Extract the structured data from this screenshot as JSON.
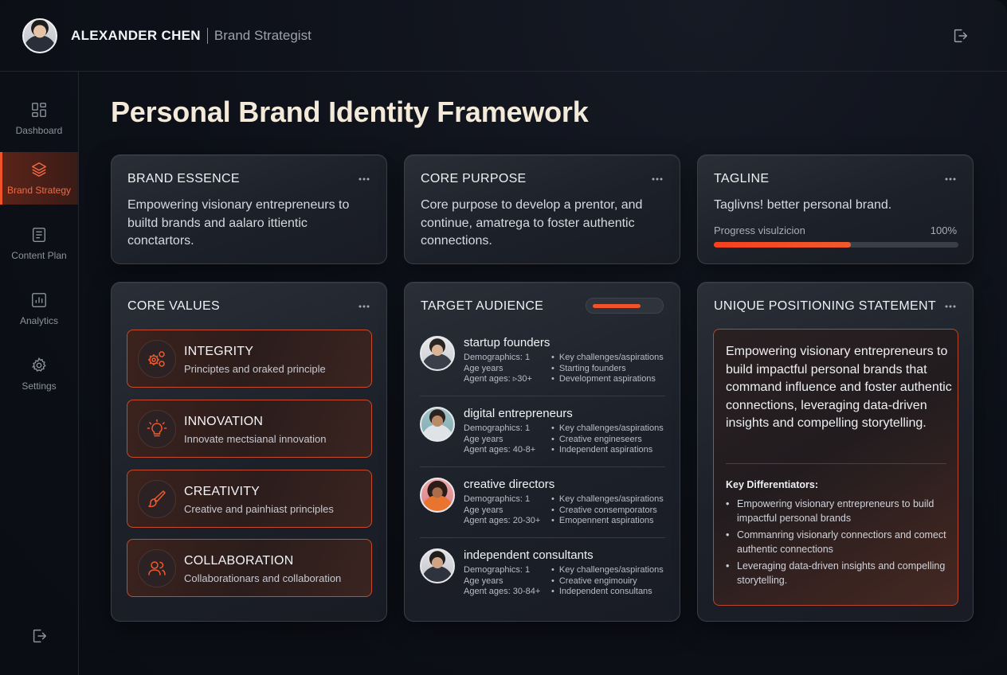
{
  "user": {
    "name": "ALEXANDER CHEN",
    "role": "Brand Strategist"
  },
  "sidebar": {
    "items": [
      {
        "label": "Dashboard",
        "icon": "grid-icon"
      },
      {
        "label": "Brand Strategy",
        "icon": "layers-icon",
        "active": true
      },
      {
        "label": "Content Plan",
        "icon": "document-icon"
      },
      {
        "label": "Analytics",
        "icon": "bar-chart-icon"
      },
      {
        "label": "Settings",
        "icon": "gear-icon"
      }
    ]
  },
  "page": {
    "title": "Personal Brand Identity Framework"
  },
  "cards": {
    "brand_essence": {
      "title": "BRAND ESSENCE",
      "text": "Empowering visionary entrepreneurs to builtd brands and aalaro ittientic conctartors."
    },
    "core_purpose": {
      "title": "CORE PURPOSE",
      "text": "Core purpose to develop a prentor, and continue, amatrega to foster authentic connections."
    },
    "tagline": {
      "title": "TAGLINE",
      "text": "Taglivns! better personal brand.",
      "progress_label": "Progress visulzicion",
      "progress_pct_text": "100%",
      "progress_fill": 0.56
    },
    "core_values": {
      "title": "CORE VALUES",
      "items": [
        {
          "title": "INTEGRITY",
          "desc": "Principtes and oraked principle",
          "icon": "gears-icon"
        },
        {
          "title": "INNOVATION",
          "desc": "Innovate mectsianal innovation",
          "icon": "lightbulb-icon"
        },
        {
          "title": "CREATIVITY",
          "desc": "Creative and painhiast principles",
          "icon": "brush-icon"
        },
        {
          "title": "COLLABORATION",
          "desc": "Collaborationars and collaboration",
          "icon": "people-icon"
        }
      ]
    },
    "target_audience": {
      "title": "TARGET AUDIENCE",
      "indicator_fill": 0.7,
      "personas": [
        {
          "name": "startup founders",
          "left": [
            "Demographics: 1",
            "Age years",
            "Agent ages: ▹30+"
          ],
          "right": [
            "Key challenges/aspirations",
            "Starting founders",
            "Development  aspirations"
          ]
        },
        {
          "name": "digital entrepreneurs",
          "left": [
            "Demographics: 1",
            "Age years",
            "Agent ages: 40-8+"
          ],
          "right": [
            "Key challenges/aspirations",
            "Creative engineseers",
            "Independent aspirations"
          ]
        },
        {
          "name": "creative directors",
          "left": [
            "Demographics: 1",
            "Age years",
            "Agent ages: 20-30+"
          ],
          "right": [
            "Key challenges/aspirations",
            "Creative consemporators",
            "Emopennent aspirations"
          ]
        },
        {
          "name": "independent consultants",
          "left": [
            "Demographics: 1",
            "Age years",
            "Agent ages: 30-84+"
          ],
          "right": [
            "Key challenges/aspirations",
            "Creative engimouiry",
            "Independent consultans"
          ]
        }
      ]
    },
    "usp": {
      "title": "UNIQUE POSITIONING STATEMENT",
      "statement": "Empowering visionary entrepreneurs to build impactful personal brands that command influence and foster authentic connections, leveraging data-driven insights and compelling storytelling.",
      "differentiators_title": "Key Differentiators:",
      "differentiators": [
        "Empowering visionary entrepreneurs to build impactful personal brands",
        "Commanring visionarly connectiors and comect authentic connections",
        "Leveraging data-driven insights and compelling storytelling."
      ]
    }
  },
  "colors": {
    "accent": "#f0522a",
    "background": "#0d1018",
    "card": "#1f232c"
  }
}
